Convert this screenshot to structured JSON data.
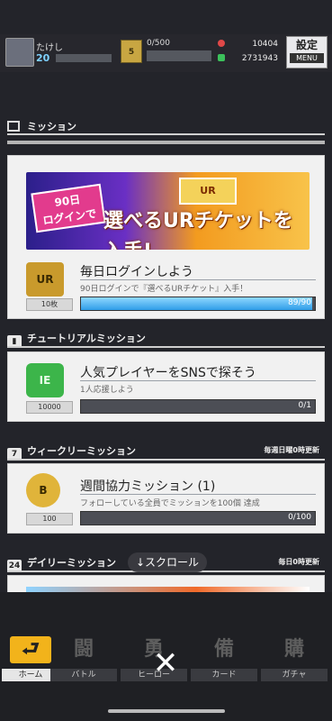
{
  "status": {
    "player_name": "たけし",
    "level": "20",
    "rank_badge": "5",
    "stamina": "0/500",
    "currency_red": "10404",
    "currency_green": "2731943",
    "settings_label": "設定",
    "menu_label": "MENU"
  },
  "panel": {
    "title": "ミッション"
  },
  "banner": {
    "days_text": "90日\nログインで",
    "main_text": "選べるURチケットを入手!",
    "ur_label": "UR"
  },
  "missions": [
    {
      "title": "毎日ログインしよう",
      "desc": "90日ログインで『選べるURチケット』入手！",
      "qty": "10枚",
      "progress_text": "89/90",
      "progress": 0.989,
      "icon": "ur-ticket-icon"
    },
    {
      "title": "人気プレイヤーをSNSで探そう",
      "desc": "1人応援しよう",
      "qty": "10000",
      "progress_text": "0/1",
      "progress": 0.0,
      "icon": "green-medal-icon"
    },
    {
      "title": "週間協力ミッション (1)",
      "desc": "フォローしている全員でミッションを100個 達成",
      "qty": "100",
      "progress_text": "0/100",
      "progress": 0.0,
      "icon": "gold-coin-icon"
    }
  ],
  "sections": {
    "tutorial": "チュートリアルミッション",
    "weekly": "ウィークリーミッション",
    "weekly_reset": "毎週日曜0時更新",
    "daily": "デイリーミッション",
    "daily_reset": "毎日0時更新"
  },
  "scroll_hint": "↓スクロール",
  "nav": [
    {
      "label": "ホーム",
      "icon": "home-icon"
    },
    {
      "label": "バトル",
      "icon": "battle-icon"
    },
    {
      "label": "ヒーロー",
      "icon": "hero-icon"
    },
    {
      "label": "カード",
      "icon": "card-icon"
    },
    {
      "label": "ガチャ",
      "icon": "gacha-icon"
    }
  ],
  "nav_glyphs": {
    "home": "⮐",
    "battle": "闘",
    "hero": "勇",
    "card": "備",
    "gacha": "購"
  },
  "close_glyph": "✕",
  "colors": {
    "accent": "#2f9de8",
    "nav_active": "#f2b31b",
    "card_bg": "#f1f1f1"
  }
}
